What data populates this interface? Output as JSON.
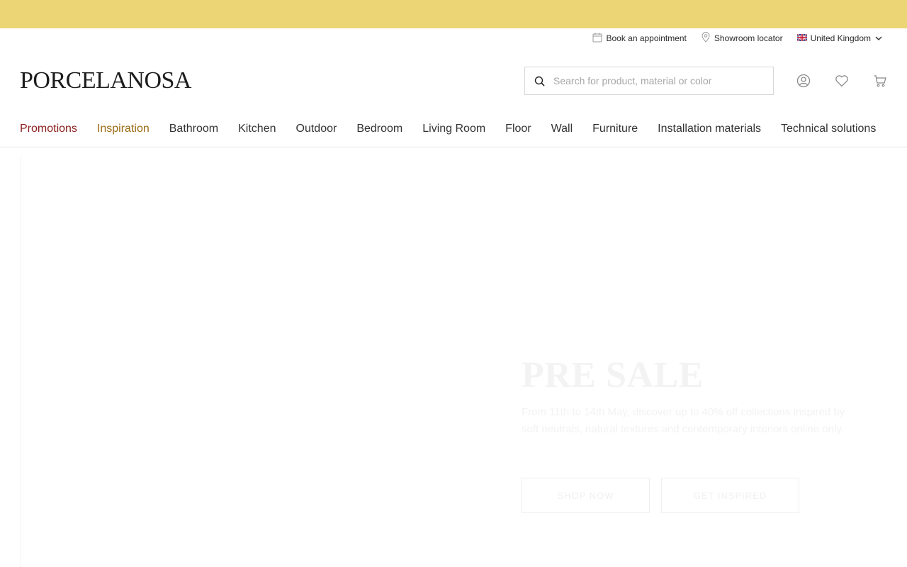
{
  "promo_bar": {
    "text": "",
    "background": "#ecd574"
  },
  "utility": {
    "appointment_label": "Book an appointment",
    "showroom_label": "Showroom locator",
    "country_label": "United Kingdom",
    "icons": [
      "calendar-icon",
      "location-pin-icon",
      "uk-flag-icon",
      "chevron-down-icon"
    ]
  },
  "header": {
    "logo_text": "PORCELANOSA",
    "search_placeholder": "Search for product, material or color",
    "search_value": "",
    "icons": [
      "account-icon",
      "wishlist-heart-icon",
      "cart-icon"
    ]
  },
  "nav": {
    "items": [
      {
        "label": "Promotions",
        "color": "#8b1d1d"
      },
      {
        "label": "Inspiration",
        "color": "#9a6b12"
      },
      {
        "label": "Bathroom"
      },
      {
        "label": "Kitchen"
      },
      {
        "label": "Outdoor"
      },
      {
        "label": "Bedroom"
      },
      {
        "label": "Living Room"
      },
      {
        "label": "Floor"
      },
      {
        "label": "Wall"
      },
      {
        "label": "Furniture"
      },
      {
        "label": "Installation materials"
      },
      {
        "label": "Technical solutions"
      }
    ]
  },
  "hero": {
    "title": "PRE SALE",
    "description": "From 11th to 14th May, discover up to 40% off collections inspired by soft neutrals, natural textures and contemporary interiors online only.",
    "primary_button": "SHOP NOW",
    "secondary_button": "GET INSPIRED"
  }
}
